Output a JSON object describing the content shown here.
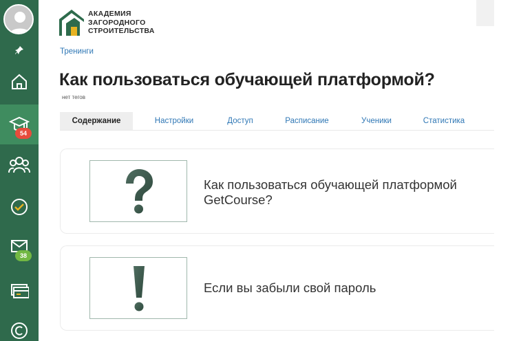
{
  "logo": {
    "line1": "АКАДЕМИЯ",
    "line2": "ЗАГОРОДНОГО",
    "line3": "СТРОИТЕЛЬСТВА",
    "color_dark": "#2e6b4c",
    "color_accent": "#e7b322"
  },
  "sidebar": {
    "bg_color": "#2f6a4c",
    "items": [
      {
        "icon": "home-icon"
      },
      {
        "icon": "graduation-cap-icon",
        "badge": "54",
        "active": true
      },
      {
        "icon": "users-icon"
      },
      {
        "icon": "check-circle-icon"
      },
      {
        "icon": "mail-icon",
        "badge": "38"
      },
      {
        "icon": "payments-icon"
      },
      {
        "icon": "copyright-icon"
      }
    ]
  },
  "breadcrumb": "Тренинги",
  "page": {
    "title": "Как пользоваться обучающей платформой?",
    "tags": "нет тегов"
  },
  "tabs": [
    {
      "label": "Содержание",
      "active": true
    },
    {
      "label": "Настройки"
    },
    {
      "label": "Доступ"
    },
    {
      "label": "Расписание"
    },
    {
      "label": "Ученики"
    },
    {
      "label": "Статистика"
    }
  ],
  "lessons": [
    {
      "title": "Как пользоваться обучающей платформой GetCourse?",
      "symbol": "?",
      "icon": "question-icon"
    },
    {
      "title": "Если вы забыли свой пароль",
      "symbol": "!",
      "icon": "exclamation-icon"
    }
  ]
}
